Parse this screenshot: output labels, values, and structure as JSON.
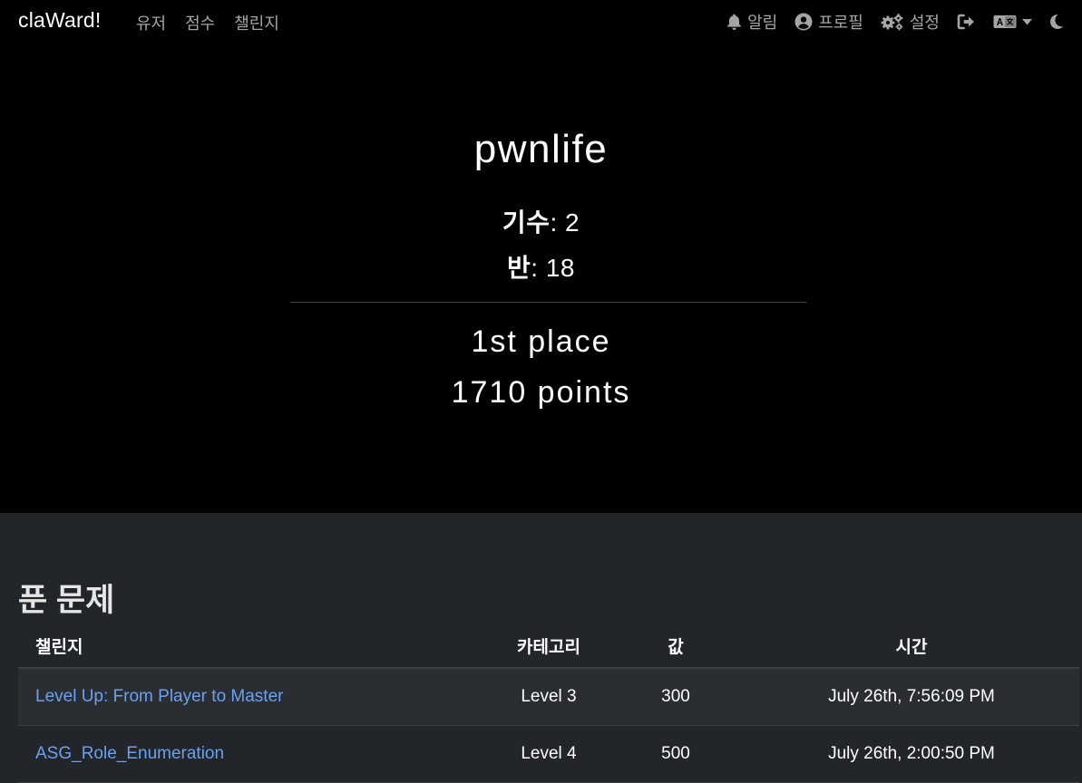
{
  "navbar": {
    "brand": "claWard!",
    "left_items": [
      {
        "label": "유저"
      },
      {
        "label": "점수"
      },
      {
        "label": "챌린지"
      }
    ],
    "notifications_label": "알림",
    "profile_label": "프로필",
    "settings_label": "설정"
  },
  "profile": {
    "username": "pwnlife",
    "cohort_label": "기수",
    "cohort_value": ": 2",
    "class_label": "반",
    "class_value": ": 18",
    "place": "1st place",
    "points": "1710 points"
  },
  "solves": {
    "title": "푼 문제",
    "headers": {
      "challenge": "챌린지",
      "category": "카테고리",
      "value": "값",
      "time": "시간"
    },
    "rows": [
      {
        "name": "Level Up: From Player to Master",
        "category": "Level 3",
        "value": "300",
        "time": "July 26th, 7:56:09 PM"
      },
      {
        "name": "ASG_Role_Enumeration",
        "category": "Level 4",
        "value": "500",
        "time": "July 26th, 2:00:50 PM"
      }
    ]
  }
}
